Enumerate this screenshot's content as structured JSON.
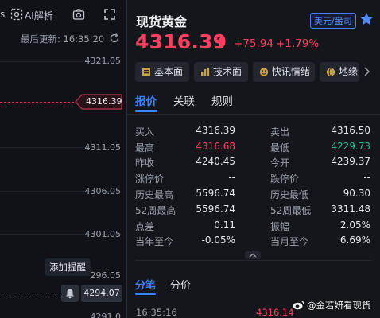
{
  "left": {
    "toolbar": {
      "fragment": "s",
      "ai_label": "AI解析"
    },
    "last_update": "最后更新: 16:35:20",
    "ticks": [
      "4321.05",
      "4311.05",
      "4306.05",
      "4301.05",
      "296.05",
      "4291.0"
    ],
    "current_price_flag": "4316.39",
    "tooltip": "添加提醒",
    "alert_price": "4294.07"
  },
  "header": {
    "title": "现货黄金",
    "unit": "美元/盎司",
    "price": "4316.39",
    "change": "+75.94",
    "change_pct": "+1.79%"
  },
  "chips": [
    "基本面",
    "技术面",
    "快讯情绪",
    "地缘"
  ],
  "tabs": [
    "报价",
    "关联",
    "规则"
  ],
  "quote": {
    "left": [
      {
        "label": "买入",
        "value": "4316.39"
      },
      {
        "label": "最高",
        "value": "4316.68"
      },
      {
        "label": "昨收",
        "value": "4240.45"
      },
      {
        "label": "涨停价",
        "value": "--"
      },
      {
        "label": "历史最高",
        "value": "5596.74"
      },
      {
        "label": "52周最高",
        "value": "5596.74"
      },
      {
        "label": "点差",
        "value": "0.11"
      },
      {
        "label": "当年至今",
        "value": "-0.05%"
      }
    ],
    "right": [
      {
        "label": "卖出",
        "value": "4316.50"
      },
      {
        "label": "最低",
        "value": "4229.73"
      },
      {
        "label": "今开",
        "value": "4239.37"
      },
      {
        "label": "跌停价",
        "value": "--"
      },
      {
        "label": "历史最低",
        "value": "90.30"
      },
      {
        "label": "52周最低",
        "value": "3311.48"
      },
      {
        "label": "振幅",
        "value": "2.05%"
      },
      {
        "label": "当月至今",
        "value": "6.69%"
      }
    ]
  },
  "ticks_section": {
    "tabs": [
      "分笔",
      "分价"
    ],
    "rows": [
      {
        "time": "16:35:16",
        "price": "4316.14"
      }
    ]
  },
  "watermark": "@金若妍看现货",
  "colors": {
    "up": "#ff3f5f",
    "down": "#1fbf8f",
    "accent": "#3b82ff",
    "bg": "#14161c"
  }
}
